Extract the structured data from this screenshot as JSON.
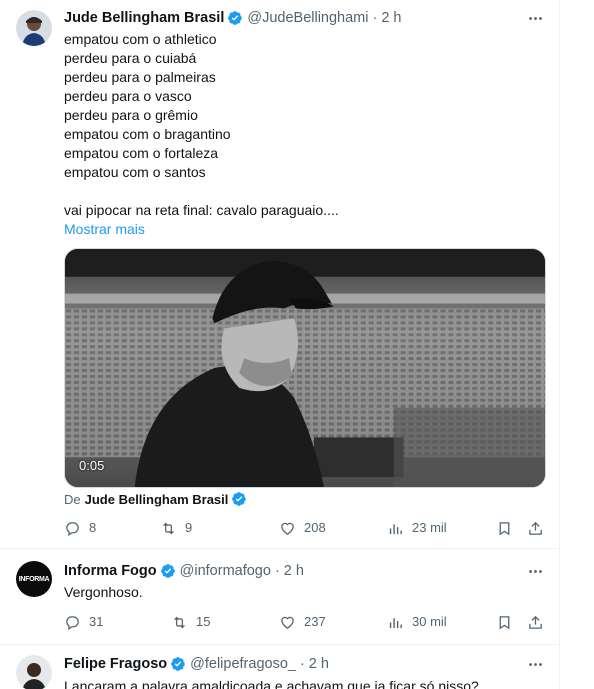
{
  "tweets": [
    {
      "name": "Jude Bellingham Brasil",
      "handle": "@JudeBellinghami",
      "time": "2 h",
      "lines": [
        "empatou com o athletico",
        "perdeu para o cuiabá",
        "perdeu para o palmeiras",
        "perdeu para o vasco",
        "perdeu para o grêmio",
        "empatou com o bragantino",
        "empatou com o fortaleza",
        "empatou com o santos",
        "",
        "vai pipocar na reta final: cavalo paraguaio...."
      ],
      "show_more": "Mostrar mais",
      "video_time": "0:05",
      "source_prefix": "De",
      "source_name": "Jude Bellingham Brasil",
      "replies": "8",
      "reposts": "9",
      "likes": "208",
      "views": "23 mil"
    },
    {
      "name": "Informa Fogo",
      "handle": "@informafogo",
      "time": "2 h",
      "text": "Vergonhoso.",
      "avatar_text": "INFORMA",
      "replies": "31",
      "reposts": "15",
      "likes": "237",
      "views": "30 mil"
    },
    {
      "name": "Felipe Fragoso",
      "handle": "@felipefragoso_",
      "time": "2 h",
      "text": "Lançaram a palavra amaldiçoada e achavam que ia ficar só nisso?"
    }
  ],
  "colors": {
    "accent": "#1d9bf0",
    "secondary_text": "#536471",
    "border": "#eff3f4"
  },
  "icons": [
    "verified-badge-icon",
    "more-icon",
    "reply-icon",
    "repost-icon",
    "like-icon",
    "views-icon",
    "bookmark-icon",
    "share-icon"
  ]
}
